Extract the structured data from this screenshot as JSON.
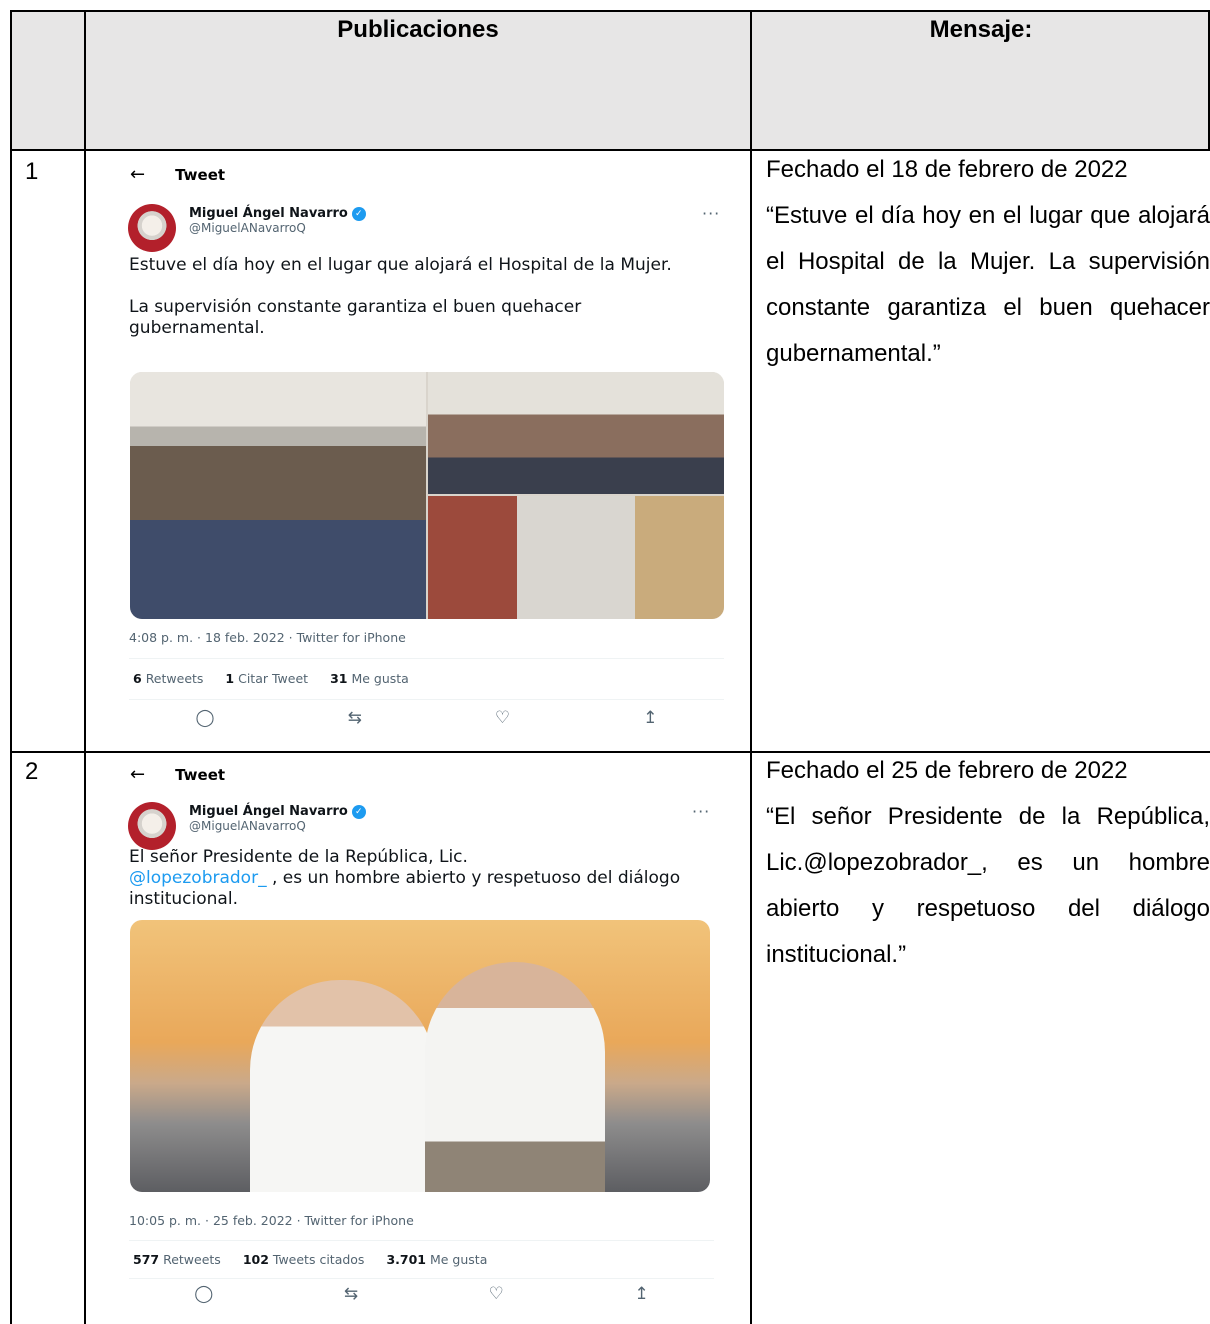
{
  "table": {
    "headers": {
      "publicaciones": "Publicaciones",
      "mensaje": "Mensaje:"
    },
    "rows": [
      {
        "number": "1",
        "message_date": "Fechado el 18 de febrero de 2022",
        "message_quote": "“Estuve el día hoy en el lugar que alojará el Hospital de la Mujer. La supervisión constante garantiza el buen quehacer gubernamental.”",
        "tweet": {
          "back": "←",
          "header": "Tweet",
          "author_name": "Miguel Ángel Navarro",
          "author_handle": "@MiguelANavarroQ",
          "more": "···",
          "paragraphs": [
            "Estuve el día hoy en el lugar que alojará el Hospital de la Mujer.",
            "La supervisión constante garantiza el buen quehacer gubernamental."
          ],
          "timestamp": "4:08 p. m. · 18 feb. 2022 · Twitter for iPhone",
          "stats": [
            {
              "count": "6",
              "label": "Retweets"
            },
            {
              "count": "1",
              "label": "Citar Tweet"
            },
            {
              "count": "31",
              "label": "Me gusta"
            }
          ]
        }
      },
      {
        "number": "2",
        "message_date": "Fechado el 25 de febrero de 2022",
        "message_quote": "“El señor Presidente de la República, Lic.@lopezobrador_, es un hombre abierto y respetuoso del diálogo institucional.”",
        "tweet": {
          "back": "←",
          "header": "Tweet",
          "author_name": "Miguel Ángel Navarro",
          "author_handle": "@MiguelANavarroQ",
          "more": "···",
          "text_before": "El señor Presidente de la República, Lic.",
          "mention": "@lopezobrador_",
          "text_after": " , es un hombre abierto y respetuoso del diálogo institucional.",
          "timestamp": "10:05 p. m. · 25 feb. 2022 · Twitter for iPhone",
          "stats": [
            {
              "count": "577",
              "label": "Retweets"
            },
            {
              "count": "102",
              "label": "Tweets citados"
            },
            {
              "count": "3.701",
              "label": "Me gusta"
            }
          ]
        }
      }
    ]
  },
  "icons": {
    "reply": "reply-icon",
    "retweet": "retweet-icon",
    "like": "heart-icon",
    "share": "share-icon",
    "verified": "verified-badge-icon",
    "back": "back-arrow-icon"
  },
  "colors": {
    "header_bg": "#e7e6e6",
    "twitter_blue": "#1d9bf0",
    "meta_gray": "#536471"
  }
}
